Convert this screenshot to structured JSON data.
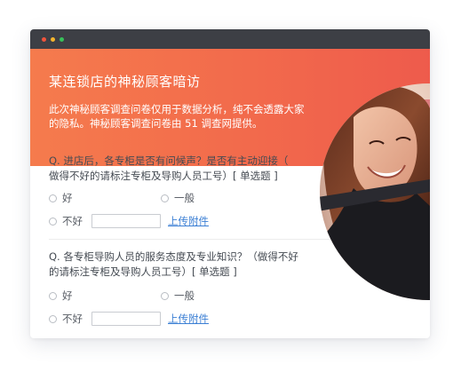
{
  "banner": {
    "title": "某连锁店的神秘顾客暗访",
    "description": "此次神秘顾客调查问卷仅用于数据分析，纯不会透露大家\n的隐私。神秘顾客调查问卷由 51 调查网提供。"
  },
  "questions": [
    {
      "text": "Q. 进店后，各专柜是否有问候声？是否有主动迎接（\n    做得不好的请标注专柜及导购人员工号）[ 单选题 ]",
      "options": [
        "好",
        "一般",
        "不好"
      ],
      "upload_label": "上传附件"
    },
    {
      "text": "Q. 各专柜导购人员的服务态度及专业知识？（做得不好\n    的请标注专柜及导购人员工号）[ 单选题 ]",
      "options": [
        "好",
        "一般",
        "不好"
      ],
      "upload_label": "上传附件"
    }
  ],
  "colors": {
    "titlebar": "#3d3f45",
    "banner_start": "#f57b4d",
    "banner_end": "#ee5b4c",
    "link": "#3b7fd4"
  }
}
